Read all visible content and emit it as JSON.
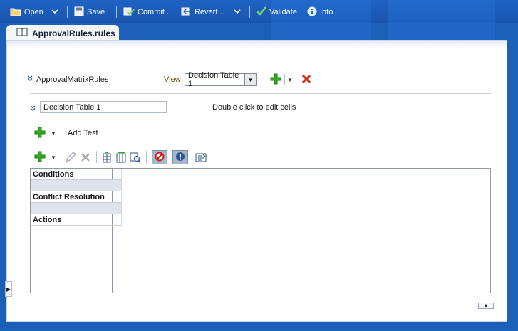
{
  "toolbar": {
    "open_label": "Open",
    "save_label": "Save",
    "commit_label": "Commit ..",
    "revert_label": "Revert ..",
    "validate_label": "Validate",
    "info_label": "Info",
    "icons": [
      "folder-icon",
      "chevron-down-icon",
      "save-icon",
      "commit-icon",
      "revert-icon",
      "validate-check-icon",
      "info-icon"
    ]
  },
  "tab": {
    "label": "ApprovalRules.rules",
    "icon": "book-icon"
  },
  "ruleset": {
    "name": "ApprovalMatrixRules",
    "view_label": "View",
    "view_selected": "Decision Table 1"
  },
  "decision_table": {
    "name": "Decision Table 1",
    "hint": "Double click to edit cells",
    "add_test_label": "Add Test",
    "rows": [
      {
        "label": "Conditions",
        "shaded": false
      },
      {
        "label": "",
        "shaded": true
      },
      {
        "label": "Conflict Resolution",
        "shaded": false
      },
      {
        "label": "",
        "shaded": true
      },
      {
        "label": "Actions",
        "shaded": false
      }
    ]
  },
  "colors": {
    "toolbar_bg": "#1f63c4",
    "add_green": "#2fae1f",
    "delete_red": "#d02a1b",
    "toggle_active_bg": "#a9b6c9"
  }
}
